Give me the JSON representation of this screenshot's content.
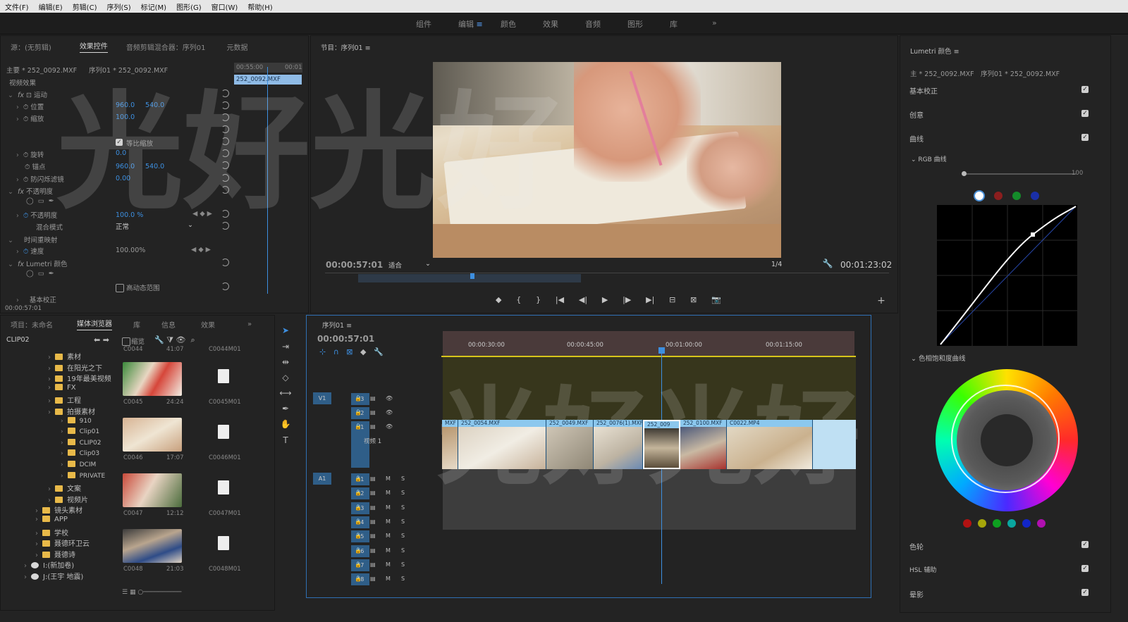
{
  "menu": [
    "文件(F)",
    "编辑(E)",
    "剪辑(C)",
    "序列(S)",
    "标记(M)",
    "图形(G)",
    "窗口(W)",
    "帮助(H)"
  ],
  "workspaces": {
    "items": [
      "组件",
      "编辑",
      "颜色",
      "效果",
      "音频",
      "图形",
      "库"
    ],
    "active": "编辑",
    "more": "»"
  },
  "effect_controls": {
    "tabs": [
      "源：(无剪辑)",
      "效果控件",
      "音频剪辑混合器：序列01",
      "元数据"
    ],
    "master": "主要 * 252_0092.MXF",
    "sequence": "序列01 * 252_0092.MXF",
    "section": "视频效果",
    "motion": "运动",
    "position": {
      "label": "位置",
      "x": "960.0",
      "y": "540.0"
    },
    "scale": {
      "label": "缩放",
      "value": "100.0"
    },
    "uniform_scale": "等比缩放",
    "rotation": {
      "label": "旋转",
      "value": "0.0"
    },
    "anchor": {
      "label": "锚点",
      "x": "960.0",
      "y": "540.0"
    },
    "anti_flicker": {
      "label": "防闪烁滤镜",
      "value": "0.00"
    },
    "opacity_group": "不透明度",
    "opacity": {
      "label": "不透明度",
      "value": "100.0 %"
    },
    "blend": {
      "label": "混合模式",
      "value": "正常"
    },
    "time_remap": "时间重映射",
    "speed": {
      "label": "速度",
      "value": "100.00%"
    },
    "lumetri": "Lumetri 颜色",
    "hdr": "高动态范围",
    "basic": "基本校正",
    "timecode": "00:00:57:01",
    "mini_time_a": "00:55:00",
    "mini_time_b": "00:01",
    "mini_clip": "252_0092.MXF"
  },
  "program": {
    "title": "节目：序列01",
    "timecode": "00:00:57:01",
    "fit": "适合",
    "fraction": "1/4",
    "duration": "00:01:23:02"
  },
  "media_browser": {
    "tabs": [
      "项目：未命名",
      "媒体浏览器",
      "库",
      "信息",
      "效果"
    ],
    "path": "CLIP02",
    "thumb_label": "缩览",
    "tree": [
      {
        "name": "素材",
        "indent": 0
      },
      {
        "name": "在阳光之下",
        "indent": 0
      },
      {
        "name": "19年最美视频",
        "indent": 0
      },
      {
        "name": "FX",
        "indent": 0
      },
      {
        "name": "工程",
        "indent": 0
      },
      {
        "name": "拍摄素材",
        "indent": 0
      },
      {
        "name": "910",
        "indent": 1
      },
      {
        "name": "Clip01",
        "indent": 1
      },
      {
        "name": "CLIP02",
        "indent": 1
      },
      {
        "name": "Clip03",
        "indent": 1
      },
      {
        "name": "DCIM",
        "indent": 1
      },
      {
        "name": "PRIVATE",
        "indent": 1
      },
      {
        "name": "文案",
        "indent": 0
      },
      {
        "name": "视频片",
        "indent": 0
      },
      {
        "name": "镜头素材",
        "indent": -1
      },
      {
        "name": "APP",
        "indent": -1
      },
      {
        "name": "学校",
        "indent": -1
      },
      {
        "name": "聂德环卫云",
        "indent": -1
      },
      {
        "name": "聂德诗",
        "indent": -1
      },
      {
        "name": "I:(新加卷)",
        "indent": -2
      },
      {
        "name": "J:(王宇 地震)",
        "indent": -2
      }
    ],
    "items": [
      {
        "name": "C0044",
        "dur": "41:07",
        "meta": "C0044M01"
      },
      {
        "name": "C0045",
        "dur": "24:24",
        "meta": "C0045M01"
      },
      {
        "name": "C0046",
        "dur": "17:07",
        "meta": "C0046M01"
      },
      {
        "name": "C0047",
        "dur": "12:12",
        "meta": "C0047M01"
      },
      {
        "name": "C0048",
        "dur": "21:03",
        "meta": "C0048M01"
      }
    ]
  },
  "timeline": {
    "title": "序列01",
    "timecode": "00:00:57:01",
    "ruler": [
      "00:00:30:00",
      "00:00:45:00",
      "00:01:00:00",
      "00:01:15:00"
    ],
    "video_tracks": [
      "V3",
      "V2",
      "V1"
    ],
    "v1_label": "视频 1",
    "source_v": "V1",
    "source_a": "A1",
    "audio_tracks": [
      "A1",
      "A2",
      "A3",
      "A4",
      "A5",
      "A6",
      "A7",
      "A8"
    ],
    "audio_flags": [
      "M",
      "S"
    ],
    "clips": [
      "MXF",
      "252_0054.MXF",
      "252_0049.MXF",
      "252_0076(1).MXF",
      "252_009",
      "252_0100.MXF",
      "C0022.MP4"
    ]
  },
  "lumetri": {
    "title": "Lumetri 颜色",
    "master": "主 * 252_0092.MXF",
    "sequence": "序列01 * 252_0092.MXF",
    "sections": [
      "基本校正",
      "创意",
      "曲线"
    ],
    "rgb_curve": "RGB 曲线",
    "slider_max": "100",
    "hue_sat": "色相饱和度曲线",
    "bottom_sections": [
      "色轮",
      "HSL 辅助",
      "晕影"
    ]
  },
  "colors": {
    "accent": "#3d8fe0",
    "clip": "#8cc8ee",
    "audio_bg": "#3d3d3d",
    "timeline_yellow": "#d7c41a"
  },
  "watermark": "光好光好"
}
